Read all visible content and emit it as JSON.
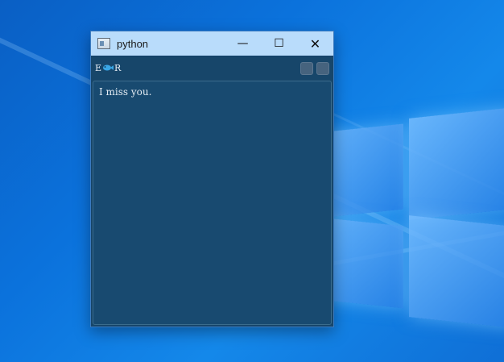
{
  "window": {
    "title": "python",
    "controls": {
      "minimize": "—",
      "maximize": "☐",
      "close": "✕"
    }
  },
  "toolbar": {
    "left_char": "E",
    "right_char": "R",
    "icon": "fish-icon"
  },
  "editor": {
    "text": "I miss you."
  },
  "colors": {
    "titlebar": "#b9dcfb",
    "client_bg": "#17466a",
    "text": "#e4ecf3",
    "desktop": "#0b72dc"
  }
}
